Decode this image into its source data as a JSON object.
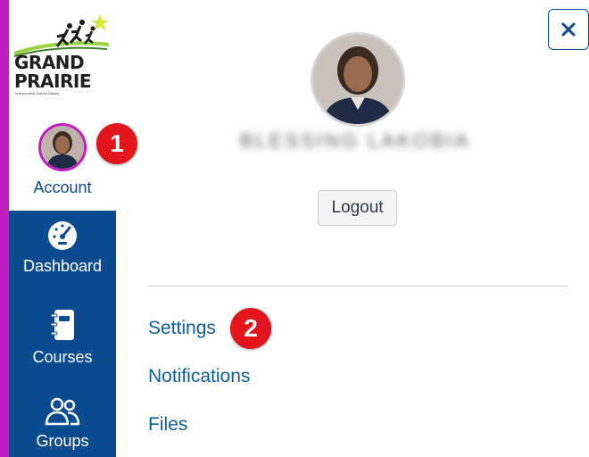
{
  "logo": {
    "line1": "GRAND",
    "line2": "PRAIRIE",
    "tagline": "Independent School District"
  },
  "global_nav": {
    "items": [
      {
        "label": "Account",
        "icon": "user-avatar"
      },
      {
        "label": "Dashboard",
        "icon": "speedometer-icon"
      },
      {
        "label": "Courses",
        "icon": "notebook-icon"
      },
      {
        "label": "Groups",
        "icon": "people-icon"
      }
    ]
  },
  "tray": {
    "user_name": "BLESSING LAKOBIA",
    "logout_label": "Logout",
    "links": [
      "Settings",
      "Notifications",
      "Files"
    ]
  },
  "steps": [
    "1",
    "2"
  ],
  "colors": {
    "nav_blue": "#0b4c91",
    "accent_magenta": "#c21dbf",
    "step_red": "#e3141c",
    "link_blue": "#0b5e94"
  }
}
